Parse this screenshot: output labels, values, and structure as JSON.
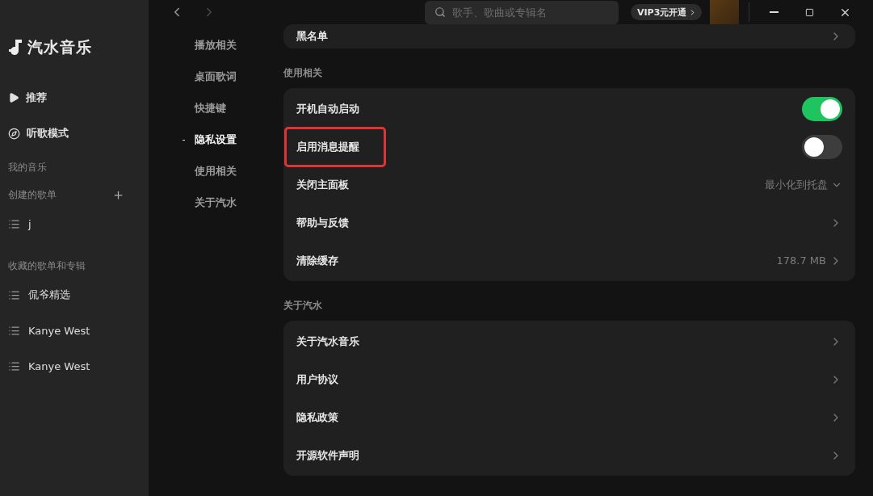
{
  "app": {
    "name": "汽水音乐"
  },
  "sidebar": {
    "nav": [
      {
        "kind": "play",
        "label": "推荐"
      },
      {
        "kind": "compass",
        "label": "听歌模式"
      }
    ],
    "sections": [
      {
        "title": "我的音乐",
        "addable": false
      },
      {
        "title": "创建的歌单",
        "addable": true,
        "items": [
          "j"
        ]
      },
      {
        "title": "收藏的歌单和专辑",
        "addable": false,
        "items": [
          "侃爷精选",
          "Kanye West",
          "Kanye West"
        ]
      }
    ]
  },
  "topbar": {
    "back_disabled": false,
    "forward_disabled": true,
    "search": {
      "placeholder": "歌手、歌曲或专辑名"
    },
    "vip_button": "VIP3元开通"
  },
  "settings_nav": [
    {
      "label": "播放相关",
      "selected": false
    },
    {
      "label": "桌面歌词",
      "selected": false
    },
    {
      "label": "快捷键",
      "selected": false
    },
    {
      "label": "隐私设置",
      "selected": true
    },
    {
      "label": "使用相关",
      "selected": false
    },
    {
      "label": "关于汽水",
      "selected": false
    }
  ],
  "groups": [
    {
      "rows": [
        {
          "kind": "link",
          "label": "黑名单"
        }
      ]
    },
    {
      "title": "使用相关",
      "rows": [
        {
          "kind": "toggle",
          "label": "开机自动启动",
          "on": true
        },
        {
          "kind": "toggle",
          "label": "启用消息提醒",
          "on": false,
          "highlighted": true
        },
        {
          "kind": "dropdown",
          "label": "关闭主面板",
          "value": "最小化到托盘"
        },
        {
          "kind": "link",
          "label": "帮助与反馈"
        },
        {
          "kind": "link",
          "label": "清除缓存",
          "value": "178.7 MB"
        }
      ]
    },
    {
      "title": "关于汽水",
      "rows": [
        {
          "kind": "link",
          "label": "关于汽水音乐"
        },
        {
          "kind": "link",
          "label": "用户协议"
        },
        {
          "kind": "link",
          "label": "隐私政策"
        },
        {
          "kind": "link",
          "label": "开源软件声明"
        }
      ]
    }
  ]
}
